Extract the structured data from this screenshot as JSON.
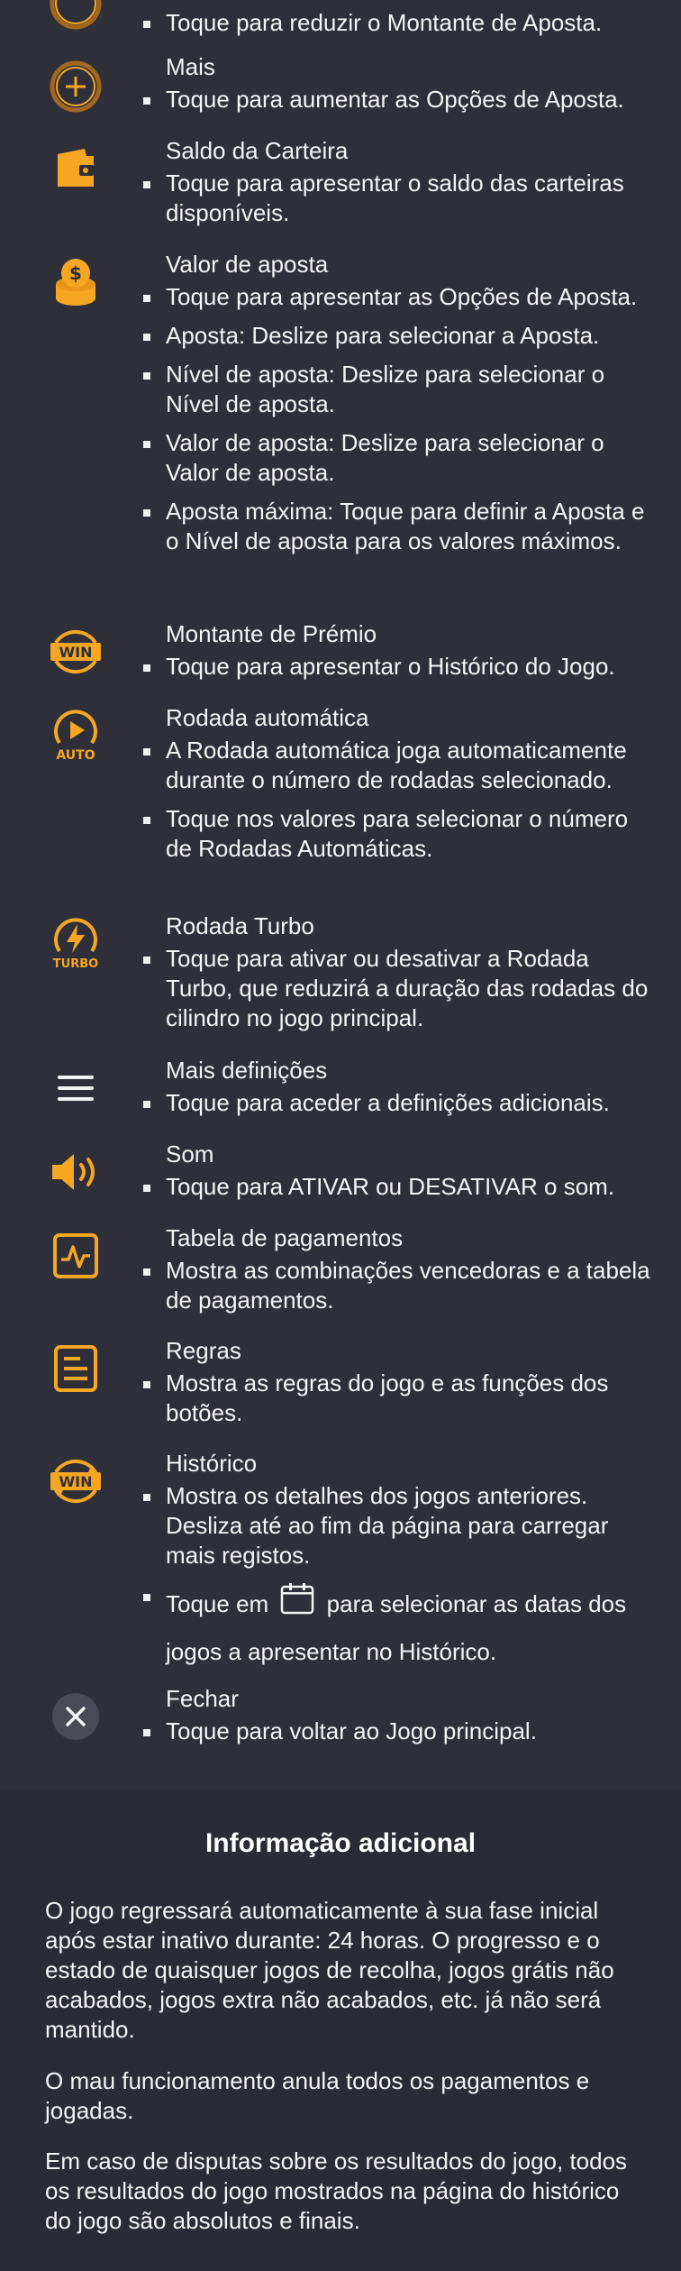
{
  "colors": {
    "background": "#2f2f3a",
    "accent": "#f5a623",
    "text": "#f4f4f4"
  },
  "items": [
    {
      "icon": "minus-icon",
      "title": "",
      "bullets": [
        "Toque para reduzir o Montante de Aposta."
      ]
    },
    {
      "icon": "plus-icon",
      "title": "Mais",
      "bullets": [
        "Toque para aumentar as Opções de Aposta."
      ]
    },
    {
      "icon": "wallet-icon",
      "title": "Saldo da Carteira",
      "bullets": [
        "Toque para apresentar o saldo das carteiras disponíveis."
      ]
    },
    {
      "icon": "coins-icon",
      "title": "Valor de aposta",
      "bullets": [
        "Toque para apresentar as Opções de Aposta.",
        "Aposta: Deslize para selecionar a Aposta.",
        "Nível de aposta: Deslize para selecionar o Nível de aposta.",
        "Valor de aposta: Deslize para selecionar o Valor de aposta.",
        "Aposta máxima: Toque para definir a Aposta e o Nível de aposta para os valores máximos."
      ]
    },
    {
      "icon": "win-icon",
      "title": "Montante de Prémio",
      "bullets": [
        "Toque para apresentar o Histórico do Jogo."
      ]
    },
    {
      "icon": "auto-play-icon",
      "icon_label": "AUTO",
      "title": "Rodada automática",
      "bullets": [
        "A Rodada automática joga automaticamente durante o número de rodadas selecionado.",
        "Toque nos valores para selecionar o número de Rodadas Automáticas."
      ]
    },
    {
      "icon": "turbo-icon",
      "icon_label": "TURBO",
      "title": "Rodada Turbo",
      "bullets": [
        "Toque para ativar ou desativar a Rodada Turbo, que reduzirá a duração das rodadas do cilindro no jogo principal."
      ]
    },
    {
      "icon": "menu-icon",
      "title": "Mais definições",
      "bullets": [
        "Toque para aceder a definições adicionais."
      ]
    },
    {
      "icon": "sound-icon",
      "title": "Som",
      "bullets": [
        "Toque para ATIVAR ou DESATIVAR o som."
      ]
    },
    {
      "icon": "paytable-icon",
      "title": "Tabela de pagamentos",
      "bullets": [
        "Mostra as combinações vencedoras e a tabela de pagamentos."
      ]
    },
    {
      "icon": "rules-icon",
      "title": "Regras",
      "bullets": [
        "Mostra as regras do jogo e as funções dos botões."
      ]
    },
    {
      "icon": "history-icon",
      "title": "Histórico",
      "bullets": [
        "Mostra os detalhes dos jogos anteriores. Desliza até ao fim da página para carregar mais registos."
      ],
      "calendar_bullet": {
        "before": "Toque em",
        "after_line1": "para selecionar as datas dos",
        "line2": "jogos a apresentar no Histórico."
      }
    },
    {
      "icon": "close-icon",
      "title": "Fechar",
      "bullets": [
        "Toque para voltar ao Jogo principal."
      ]
    }
  ],
  "icon_labels": {
    "win": "WIN"
  },
  "additional": {
    "title": "Informação adicional",
    "paragraphs": [
      "O jogo regressará automaticamente à sua fase inicial após estar inativo durante: 24 horas. O progresso e o estado de quaisquer jogos de recolha, jogos grátis não acabados, jogos extra não acabados, etc. já não será mantido.",
      "O mau funcionamento anula todos os pagamentos e jogadas.",
      "Em caso de disputas sobre os resultados do jogo, todos os resultados do jogo mostrados na página do histórico do jogo são absolutos e finais."
    ]
  }
}
